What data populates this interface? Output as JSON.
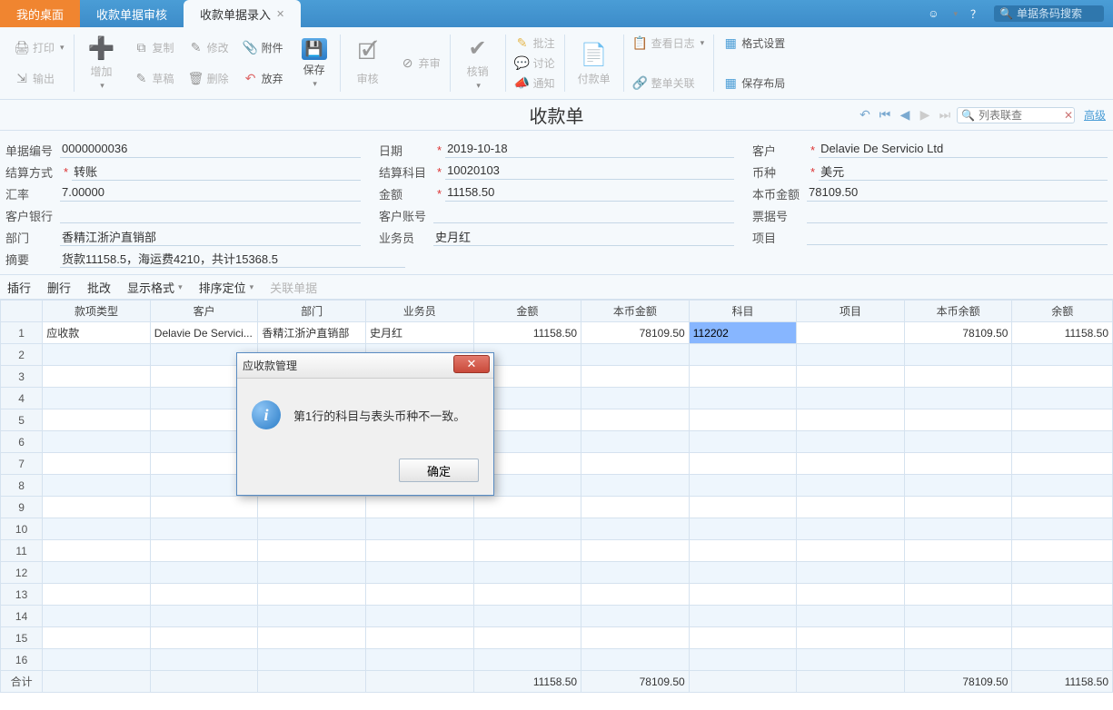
{
  "topbar": {
    "tab_desktop": "我的桌面",
    "tab_audit": "收款单据审核",
    "tab_entry": "收款单据录入",
    "search_placeholder": "单据条码搜索"
  },
  "ribbon": {
    "print": "打印",
    "output": "输出",
    "add": "增加",
    "copy": "复制",
    "draft": "草稿",
    "modify": "修改",
    "delete": "删除",
    "attach": "附件",
    "abandon": "放弃",
    "save": "保存",
    "audit": "审核",
    "reject": "弃审",
    "hexiao": "核销",
    "pizhu": "批注",
    "discuss": "讨论",
    "notify": "通知",
    "pay_bill": "付款单",
    "view_log": "查看日志",
    "link": "整单关联",
    "format": "格式设置",
    "save_layout": "保存布局"
  },
  "title": {
    "text": "收款单",
    "list_search_placeholder": "列表联查",
    "advanced": "高级"
  },
  "form": {
    "doc_no_label": "单据编号",
    "doc_no": "0000000036",
    "date_label": "日期",
    "date": "2019-10-18",
    "customer_label": "客户",
    "customer": "Delavie De Servicio Ltd",
    "settle_label": "结算方式",
    "settle": "转账",
    "subject_label": "结算科目",
    "subject": "10020103",
    "currency_label": "币种",
    "currency": "美元",
    "rate_label": "汇率",
    "rate": "7.00000",
    "amount_label": "金额",
    "amount": "11158.50",
    "base_amount_label": "本币金额",
    "base_amount": "78109.50",
    "cust_bank_label": "客户银行",
    "cust_acct_label": "客户账号",
    "bill_no_label": "票据号",
    "dept_label": "部门",
    "dept": "香精江浙沪直销部",
    "ywy_label": "业务员",
    "ywy": "史月红",
    "project_label": "项目",
    "summary_label": "摘要",
    "summary": "货款11158.5，海运费4210，共计15368.5"
  },
  "grid_toolbar": {
    "insert": "插行",
    "delete": "删行",
    "batch": "批改",
    "display": "显示格式",
    "sort": "排序定位",
    "related": "关联单据"
  },
  "columns": {
    "type": "款项类型",
    "customer": "客户",
    "dept": "部门",
    "ywy": "业务员",
    "amount": "金额",
    "base_amount": "本币金额",
    "subject": "科目",
    "project": "项目",
    "base_balance": "本币余额",
    "balance": "余额"
  },
  "rows": [
    {
      "n": "1",
      "type": "应收款",
      "customer": "Delavie De Servici...",
      "dept": "香精江浙沪直销部",
      "ywy": "史月红",
      "amount": "11158.50",
      "base_amount": "78109.50",
      "subject": "112202",
      "project": "",
      "base_balance": "78109.50",
      "balance": "11158.50"
    }
  ],
  "totals": {
    "label": "合计",
    "amount": "11158.50",
    "base_amount": "78109.50",
    "base_balance": "78109.50",
    "balance": "11158.50"
  },
  "dialog": {
    "title": "应收款管理",
    "message": "第1行的科目与表头币种不一致。",
    "ok": "确定"
  }
}
